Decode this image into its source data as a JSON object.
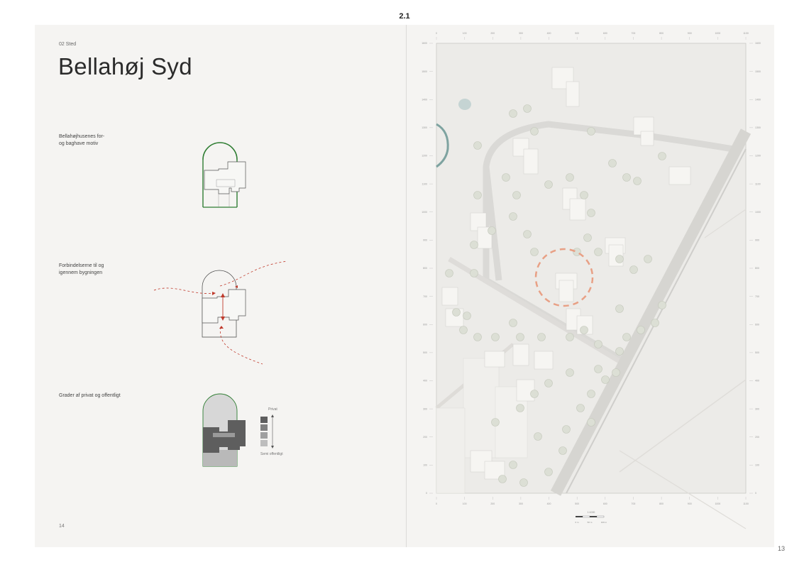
{
  "header": {
    "label": "2.1"
  },
  "footer": {
    "page_number_right": "13"
  },
  "left_page": {
    "section": "02 Sted",
    "title": "Bellahøj Syd",
    "captions": [
      "Bellahøjhusenes for-\nog baghave motiv",
      "Forbindelserne til og\nigennem bygningen",
      "Grader af privat og offentligt"
    ],
    "legend": {
      "top": "Privat",
      "bottom": "Semi offentligt"
    },
    "page_number": "14"
  },
  "map": {
    "axis_ticks_x": [
      "0",
      "100",
      "200",
      "300",
      "400",
      "500",
      "600",
      "700",
      "800",
      "900",
      "1000",
      "1100"
    ],
    "axis_ticks_y": [
      "1600",
      "1500",
      "1400",
      "1300",
      "1200",
      "1100",
      "1000",
      "900",
      "800",
      "700",
      "600",
      "500",
      "400",
      "300",
      "200",
      "100",
      "0"
    ],
    "scale_ratio": "1:1000",
    "scale_labels": [
      "0 m",
      "50 m",
      "100 m"
    ]
  },
  "colors": {
    "green": "#2e7d32",
    "red_dash": "#c0392b",
    "orange_circle": "#e8a085"
  }
}
